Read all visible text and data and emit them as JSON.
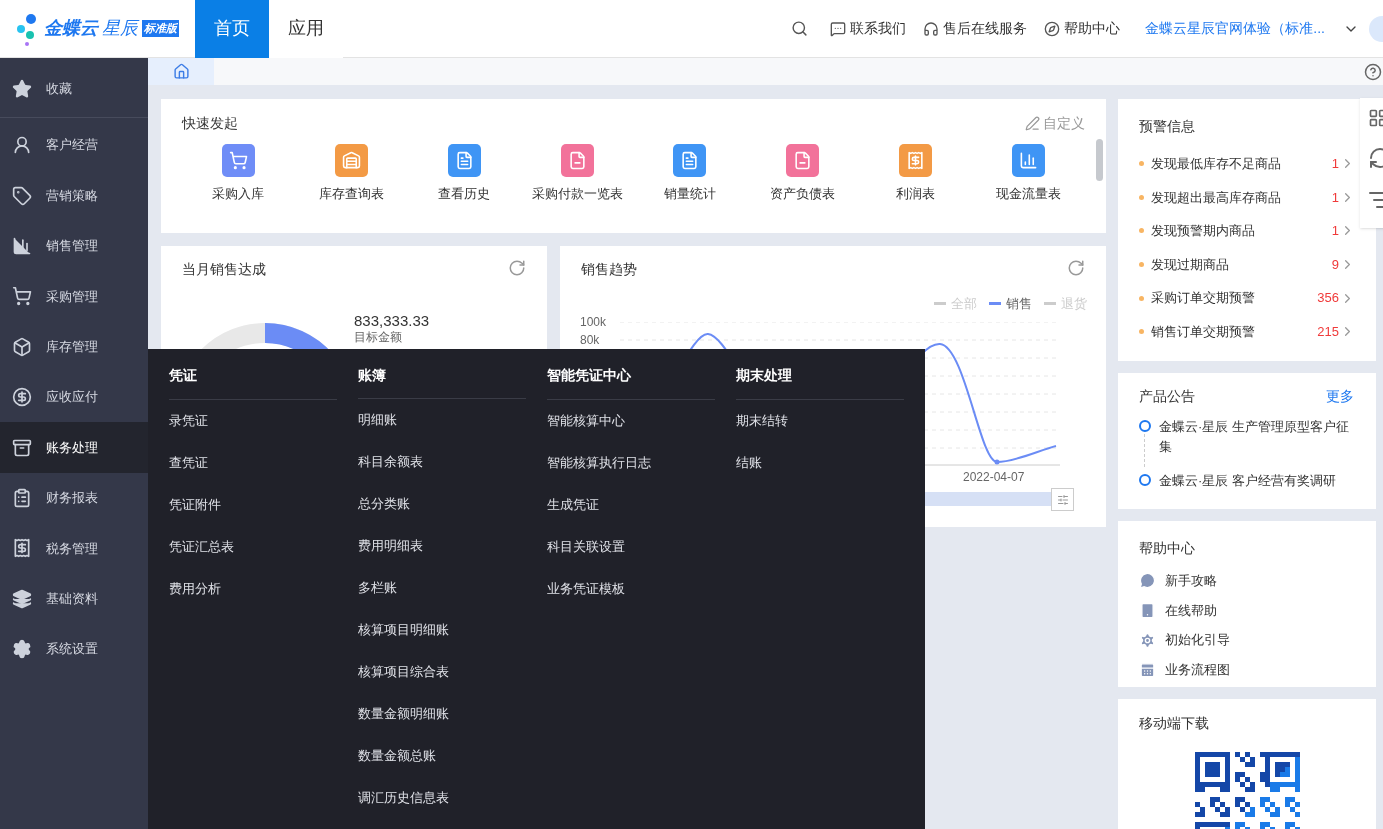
{
  "header": {
    "logo": {
      "brand": "金蝶云",
      "product": "星辰",
      "edition": "标准版"
    },
    "nav_tabs": [
      {
        "label": "首页",
        "selected": true
      },
      {
        "label": "应用",
        "selected": false
      }
    ],
    "actions": [
      "联系我们",
      "售后在线服务",
      "帮助中心"
    ],
    "account": "金蝶云星辰官网体验（标准..."
  },
  "sidebar": {
    "items": [
      {
        "label": "收藏",
        "selected": false
      },
      {
        "label": "客户经营",
        "selected": false
      },
      {
        "label": "营销策略",
        "selected": false
      },
      {
        "label": "销售管理",
        "selected": false
      },
      {
        "label": "采购管理",
        "selected": false
      },
      {
        "label": "库存管理",
        "selected": false
      },
      {
        "label": "应收应付",
        "selected": false
      },
      {
        "label": "账务处理",
        "selected": true
      },
      {
        "label": "财务报表",
        "selected": false
      },
      {
        "label": "税务管理",
        "selected": false
      },
      {
        "label": "基础资料",
        "selected": false
      },
      {
        "label": "系统设置",
        "selected": false
      }
    ]
  },
  "quick_launch": {
    "title": "快速发起",
    "customize": "自定义",
    "items": [
      "采购入库",
      "库存查询表",
      "查看历史",
      "采购付款一览表",
      "销量统计",
      "资产负债表",
      "利润表",
      "现金流量表"
    ]
  },
  "monthly_sales": {
    "title": "当月销售达成",
    "amount": "833,333.33",
    "amount_label": "目标金额"
  },
  "sales_trend": {
    "title": "销售趋势",
    "legend": [
      {
        "label": "全部",
        "selected": false
      },
      {
        "label": "销售",
        "selected": true
      },
      {
        "label": "退货",
        "selected": false
      }
    ],
    "y_ticks": [
      "100k",
      "80k"
    ],
    "x_label": "2022-04-07"
  },
  "alerts": {
    "title": "预警信息",
    "items": [
      {
        "label": "发现最低库存不足商品",
        "count": "1"
      },
      {
        "label": "发现超出最高库存商品",
        "count": "1"
      },
      {
        "label": "发现预警期内商品",
        "count": "1"
      },
      {
        "label": "发现过期商品",
        "count": "9"
      },
      {
        "label": "采购订单交期预警",
        "count": "356"
      },
      {
        "label": "销售订单交期预警",
        "count": "215"
      }
    ]
  },
  "announcements": {
    "title": "产品公告",
    "more": "更多",
    "items": [
      "金蝶云·星辰 生产管理原型客户征集",
      "金蝶云·星辰 客户经营有奖调研"
    ]
  },
  "help_center": {
    "title": "帮助中心",
    "items": [
      "新手攻略",
      "在线帮助",
      "初始化引导",
      "业务流程图"
    ]
  },
  "mobile_download": {
    "title": "移动端下载"
  },
  "menu": {
    "columns": [
      {
        "title": "凭证",
        "items": [
          "录凭证",
          "查凭证",
          "凭证附件",
          "凭证汇总表",
          "费用分析"
        ]
      },
      {
        "title": "账簿",
        "items": [
          "明细账",
          "科目余额表",
          "总分类账",
          "费用明细表",
          "多栏账",
          "核算项目明细账",
          "核算项目综合表",
          "数量金额明细账",
          "数量金额总账",
          "调汇历史信息表"
        ]
      },
      {
        "title": "智能凭证中心",
        "items": [
          "智能核算中心",
          "智能核算执行日志",
          "生成凭证",
          "科目关联设置",
          "业务凭证模板"
        ]
      },
      {
        "title": "期末处理",
        "items": [
          "期末结转",
          "结账"
        ]
      }
    ]
  }
}
